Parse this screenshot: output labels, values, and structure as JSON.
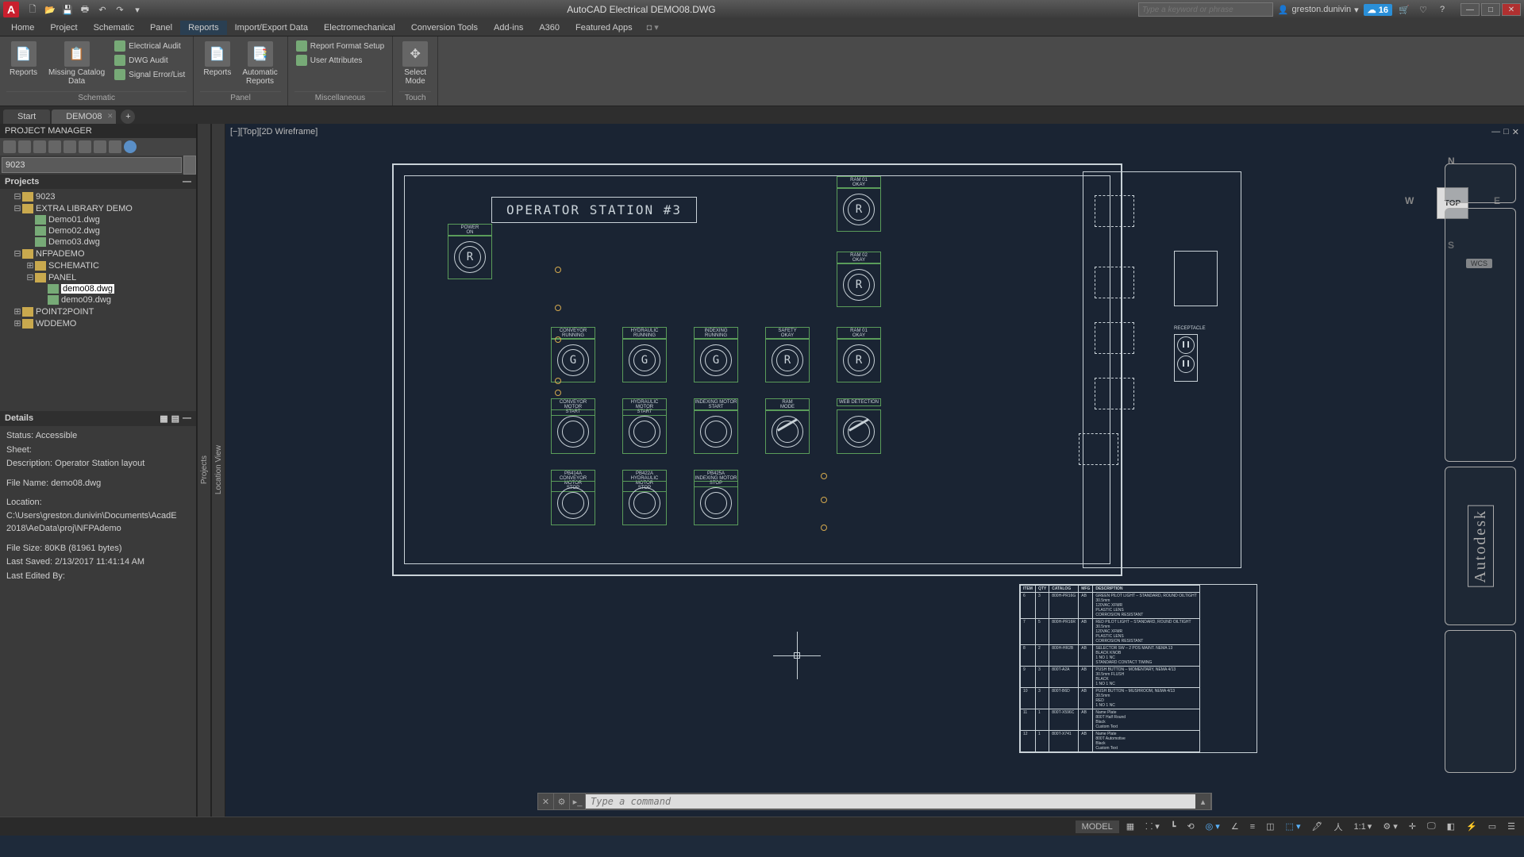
{
  "app": {
    "title": "AutoCAD Electrical   DEMO08.DWG",
    "search_placeholder": "Type a keyword or phrase",
    "user": "greston.dunivin",
    "notif_count": "16"
  },
  "qat": [
    "new",
    "open",
    "save",
    "undo",
    "redo",
    "print"
  ],
  "menu": {
    "items": [
      "Home",
      "Project",
      "Schematic",
      "Panel",
      "Reports",
      "Import/Export Data",
      "Electromechanical",
      "Conversion Tools",
      "Add-ins",
      "A360",
      "Featured Apps"
    ],
    "active": "Reports"
  },
  "ribbon": {
    "groups": [
      {
        "label": "Schematic",
        "large": [
          {
            "label": "Reports",
            "icon": "📄"
          },
          {
            "label": "Missing Catalog\nData",
            "icon": "📋"
          }
        ],
        "small": [
          "Electrical Audit",
          "DWG Audit",
          "Signal Error/List"
        ]
      },
      {
        "label": "Panel",
        "large": [
          {
            "label": "Reports",
            "icon": "📄"
          },
          {
            "label": "Automatic\nReports",
            "icon": "📑"
          }
        ],
        "small": []
      },
      {
        "label": "Miscellaneous",
        "large": [],
        "small": [
          "Report Format Setup",
          "User Attributes"
        ]
      },
      {
        "label": "Touch",
        "large": [
          {
            "label": "Select\nMode",
            "icon": "✥"
          }
        ],
        "small": []
      }
    ]
  },
  "doctabs": {
    "tabs": [
      "Start",
      "DEMO08"
    ],
    "active": "DEMO08"
  },
  "project_manager": {
    "title": "PROJECT MANAGER",
    "input_value": "9023",
    "projects_label": "Projects",
    "tree": [
      {
        "lvl": 1,
        "exp": "⊟",
        "ico": "folder",
        "name": "9023"
      },
      {
        "lvl": 1,
        "exp": "⊟",
        "ico": "folder",
        "name": "EXTRA LIBRARY DEMO"
      },
      {
        "lvl": 2,
        "exp": "",
        "ico": "dwg",
        "name": "Demo01.dwg"
      },
      {
        "lvl": 2,
        "exp": "",
        "ico": "dwg",
        "name": "Demo02.dwg"
      },
      {
        "lvl": 2,
        "exp": "",
        "ico": "dwg",
        "name": "Demo03.dwg"
      },
      {
        "lvl": 1,
        "exp": "⊟",
        "ico": "folder",
        "name": "NFPADEMO"
      },
      {
        "lvl": 2,
        "exp": "⊞",
        "ico": "folder",
        "name": "SCHEMATIC"
      },
      {
        "lvl": 2,
        "exp": "⊟",
        "ico": "folder",
        "name": "PANEL"
      },
      {
        "lvl": 3,
        "exp": "",
        "ico": "dwg",
        "name": "demo08.dwg",
        "selected": true
      },
      {
        "lvl": 3,
        "exp": "",
        "ico": "dwg",
        "name": "demo09.dwg"
      },
      {
        "lvl": 1,
        "exp": "⊞",
        "ico": "folder",
        "name": "POINT2POINT"
      },
      {
        "lvl": 1,
        "exp": "⊞",
        "ico": "folder",
        "name": "WDDEMO"
      }
    ]
  },
  "details": {
    "title": "Details",
    "status": "Status: Accessible",
    "sheet": "Sheet:",
    "description": "Description: Operator Station layout",
    "filename": "File Name: demo08.dwg",
    "location": "Location: C:\\Users\\greston.dunivin\\Documents\\AcadE 2018\\AeData\\proj\\NFPAdemo",
    "filesize": "File Size: 80KB (81961 bytes)",
    "lastsaved": "Last Saved: 2/13/2017 11:41:14 AM",
    "lastedited": "Last Edited By:"
  },
  "side_strips": {
    "projects": "Projects",
    "location": "Location View"
  },
  "canvas": {
    "header": "[−][Top][2D Wireframe]",
    "station_title": "OPERATOR STATION #3",
    "indicators": {
      "power_on": {
        "label": "POWER\nON",
        "letter": "R"
      },
      "ram01_okay": {
        "label": "RAM 01\nOKAY",
        "letter": "R"
      },
      "ram02_okay": {
        "label": "RAM 02\nOKAY",
        "letter": "R"
      },
      "conv_running": {
        "label": "CONVEYOR RUNNING",
        "letter": "G"
      },
      "hyd_running": {
        "label": "HYDRAULIC RUNNING",
        "letter": "G"
      },
      "idx_running": {
        "label": "INDEXING RUNNING",
        "letter": "G"
      },
      "safety_okay": {
        "label": "SAFETY\nOKAY",
        "letter": "R"
      },
      "ram01_okay2": {
        "label": "RAM 01\nOKAY",
        "letter": "R"
      },
      "conv_start": {
        "label": "CONVEYOR MOTOR\nSTART",
        "letter": ""
      },
      "hyd_start": {
        "label": "HYDRAULIC MOTOR\nSTART",
        "letter": ""
      },
      "idx_start": {
        "label": "INDEXING MOTOR\nSTART",
        "letter": ""
      },
      "ram_mode": {
        "label": "RAM\nMODE",
        "switch": true
      },
      "web_detect": {
        "label": "WEB DETECTION",
        "switch": true
      },
      "conv_stop": {
        "label": "PB414A\nCONVEYOR MOTOR\nSTOP",
        "letter": ""
      },
      "hyd_stop": {
        "label": "PB422A\nHYDRAULIC MOTOR\nSTOP",
        "letter": ""
      },
      "idx_stop": {
        "label": "PB425A\nINDEXING MOTOR\nSTOP",
        "letter": ""
      }
    },
    "receptacle_label": "RECEPTACLE"
  },
  "parts_table": {
    "headers": [
      "ITEM",
      "QTY",
      "CATALOG",
      "MFG",
      "DESCRIPTION"
    ],
    "rows": [
      {
        "item": "6",
        "qty": "3",
        "catalog": "800H-PR16G",
        "mfg": "AB",
        "desc": "GREEN PILOT LIGHT – STANDARD, ROUND OILTIGHT\n30.5mm\n120VAC XFMR\nPLASTIC LENS\nCORROSION RESISTANT"
      },
      {
        "item": "7",
        "qty": "5",
        "catalog": "800H-PR16R",
        "mfg": "AB",
        "desc": "RED PILOT LIGHT – STANDARD, ROUND OILTIGHT\n30.5mm\n120VAC XFMR\nPLASTIC LENS\nCORROSION RESISTANT"
      },
      {
        "item": "8",
        "qty": "2",
        "catalog": "800H-HR2B",
        "mfg": "AB",
        "desc": "SELECTOR SW – 2 POS MAINT. NEMA 13\nBLACK KNOB\n1 NO 1 NC\nSTANDARD CONTACT TIMING"
      },
      {
        "item": "9",
        "qty": "3",
        "catalog": "800T-A2A",
        "mfg": "AB",
        "desc": "PUSH BUTTON – MOMENTARY, NEMA 4/13\n30.5mm FLUSH\nBLACK\n1 NO 1 NC"
      },
      {
        "item": "10",
        "qty": "3",
        "catalog": "800T-B6D",
        "mfg": "AB",
        "desc": "PUSH BUTTON – MUSHROOM, NEMA 4/13\n30.5mm\nRED\n1 NO 1 NC"
      },
      {
        "item": "11",
        "qty": "1",
        "catalog": "800T-X596C",
        "mfg": "AB",
        "desc": "Name Plate\n800T Half Round\nBlack\nCustom Text"
      },
      {
        "item": "12",
        "qty": "1",
        "catalog": "800T-X741",
        "mfg": "AB",
        "desc": "Name Plate\n800T Automotive\nBlack\nCustom Text"
      }
    ]
  },
  "viewcube": {
    "center": "TOP",
    "n": "N",
    "s": "S",
    "e": "E",
    "w": "W",
    "wcs": "WCS"
  },
  "cmdline": {
    "placeholder": "Type a command"
  },
  "statusbar": {
    "model": "MODEL",
    "ratio": "1:1"
  }
}
